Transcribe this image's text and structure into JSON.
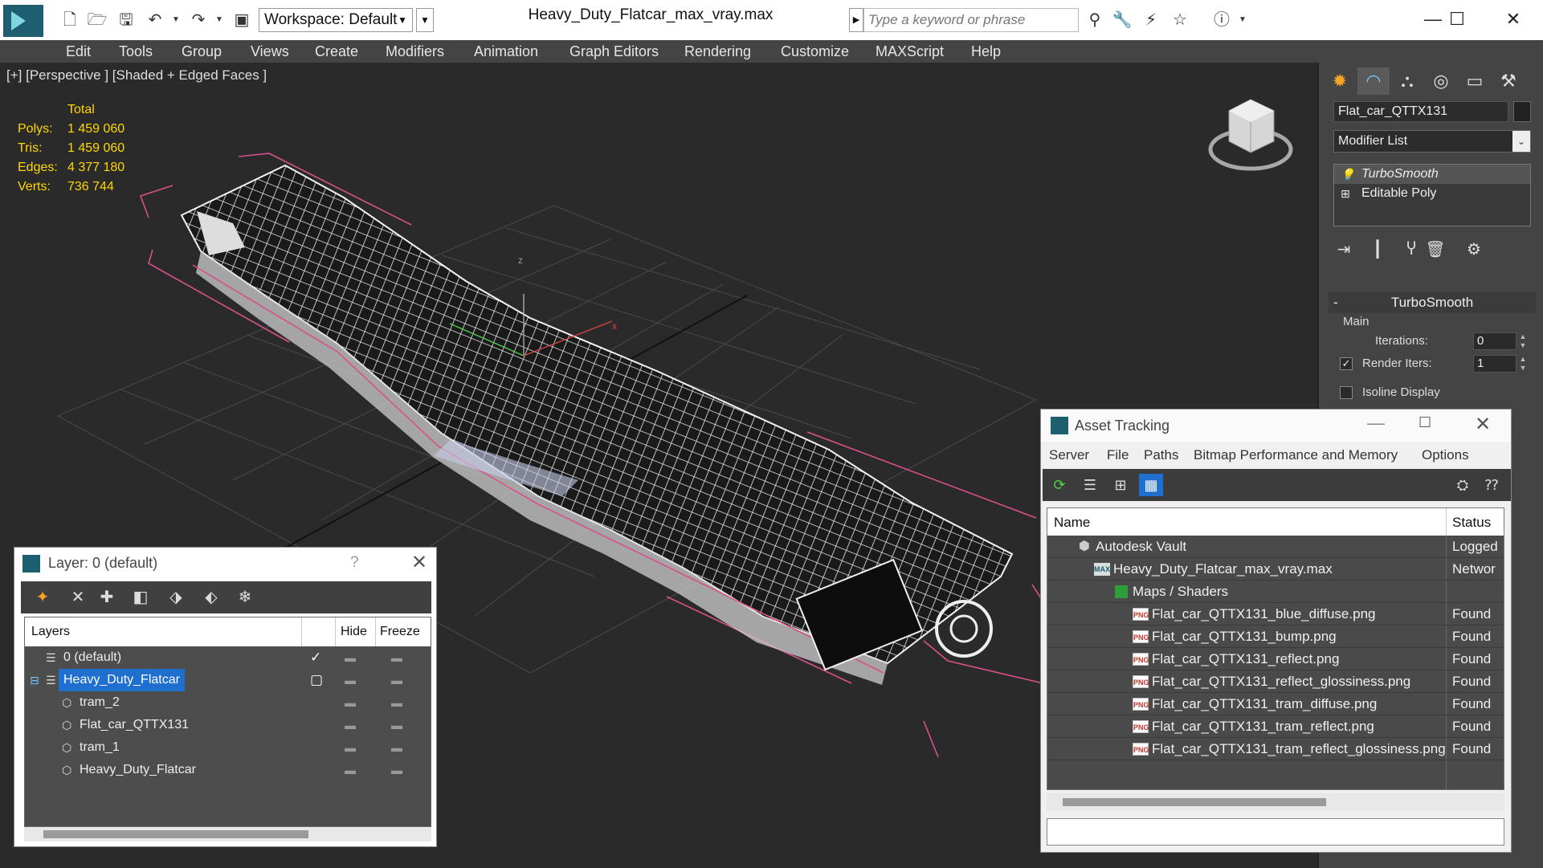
{
  "titlebar": {
    "title": "Heavy_Duty_Flatcar_max_vray.max",
    "workspace": "Workspace: Default",
    "search_placeholder": "Type a keyword or phrase"
  },
  "menu": [
    "Edit",
    "Tools",
    "Group",
    "Views",
    "Create",
    "Modifiers",
    "Animation",
    "Graph Editors",
    "Rendering",
    "Customize",
    "MAXScript",
    "Help"
  ],
  "viewport": {
    "label": "[+] [Perspective ] [Shaded + Edged Faces ]",
    "stats": {
      "header": "Total",
      "rows": [
        {
          "label": "Polys:",
          "value": "1 459 060"
        },
        {
          "label": "Tris:",
          "value": "1 459 060"
        },
        {
          "label": "Edges:",
          "value": "4 377 180"
        },
        {
          "label": "Verts:",
          "value": "736 744"
        }
      ]
    },
    "axis_z": "z",
    "axis_x": "x"
  },
  "command_panel": {
    "object_name": "Flat_car_QTTX131",
    "modifier_list": "Modifier List",
    "stack": [
      "TurboSmooth",
      "Editable Poly"
    ],
    "rollout_title": "TurboSmooth",
    "group_main": "Main",
    "iterations_label": "Iterations:",
    "iterations_value": "0",
    "render_iters_label": "Render Iters:",
    "render_iters_value": "1",
    "isoline_label": "Isoline Display"
  },
  "layer_dialog": {
    "title": "Layer: 0 (default)",
    "help": "?",
    "columns": {
      "layers": "Layers",
      "hide": "Hide",
      "freeze": "Freeze"
    },
    "rows": [
      {
        "name": "0 (default)",
        "level": 0
      },
      {
        "name": "Heavy_Duty_Flatcar",
        "level": 0
      },
      {
        "name": "tram_2",
        "level": 1
      },
      {
        "name": "Flat_car_QTTX131",
        "level": 1
      },
      {
        "name": "tram_1",
        "level": 1
      },
      {
        "name": "Heavy_Duty_Flatcar",
        "level": 1
      }
    ]
  },
  "asset_dialog": {
    "title": "Asset Tracking",
    "menu": [
      "Server",
      "File",
      "Paths",
      "Bitmap Performance and Memory",
      "Options"
    ],
    "columns": {
      "name": "Name",
      "status": "Status"
    },
    "rows": [
      {
        "name": "Autodesk Vault",
        "status": "Logged",
        "indent": 0
      },
      {
        "name": "Heavy_Duty_Flatcar_max_vray.max",
        "status": "Networ",
        "indent": 1
      },
      {
        "name": "Maps / Shaders",
        "status": "",
        "indent": 2
      },
      {
        "name": "Flat_car_QTTX131_blue_diffuse.png",
        "status": "Found",
        "indent": 3
      },
      {
        "name": "Flat_car_QTTX131_bump.png",
        "status": "Found",
        "indent": 3
      },
      {
        "name": "Flat_car_QTTX131_reflect.png",
        "status": "Found",
        "indent": 3
      },
      {
        "name": "Flat_car_QTTX131_reflect_glossiness.png",
        "status": "Found",
        "indent": 3
      },
      {
        "name": "Flat_car_QTTX131_tram_diffuse.png",
        "status": "Found",
        "indent": 3
      },
      {
        "name": "Flat_car_QTTX131_tram_reflect.png",
        "status": "Found",
        "indent": 3
      },
      {
        "name": "Flat_car_QTTX131_tram_reflect_glossiness.png",
        "status": "Found",
        "indent": 3
      }
    ],
    "png_badge": "PNG",
    "max_badge": "MAX"
  }
}
